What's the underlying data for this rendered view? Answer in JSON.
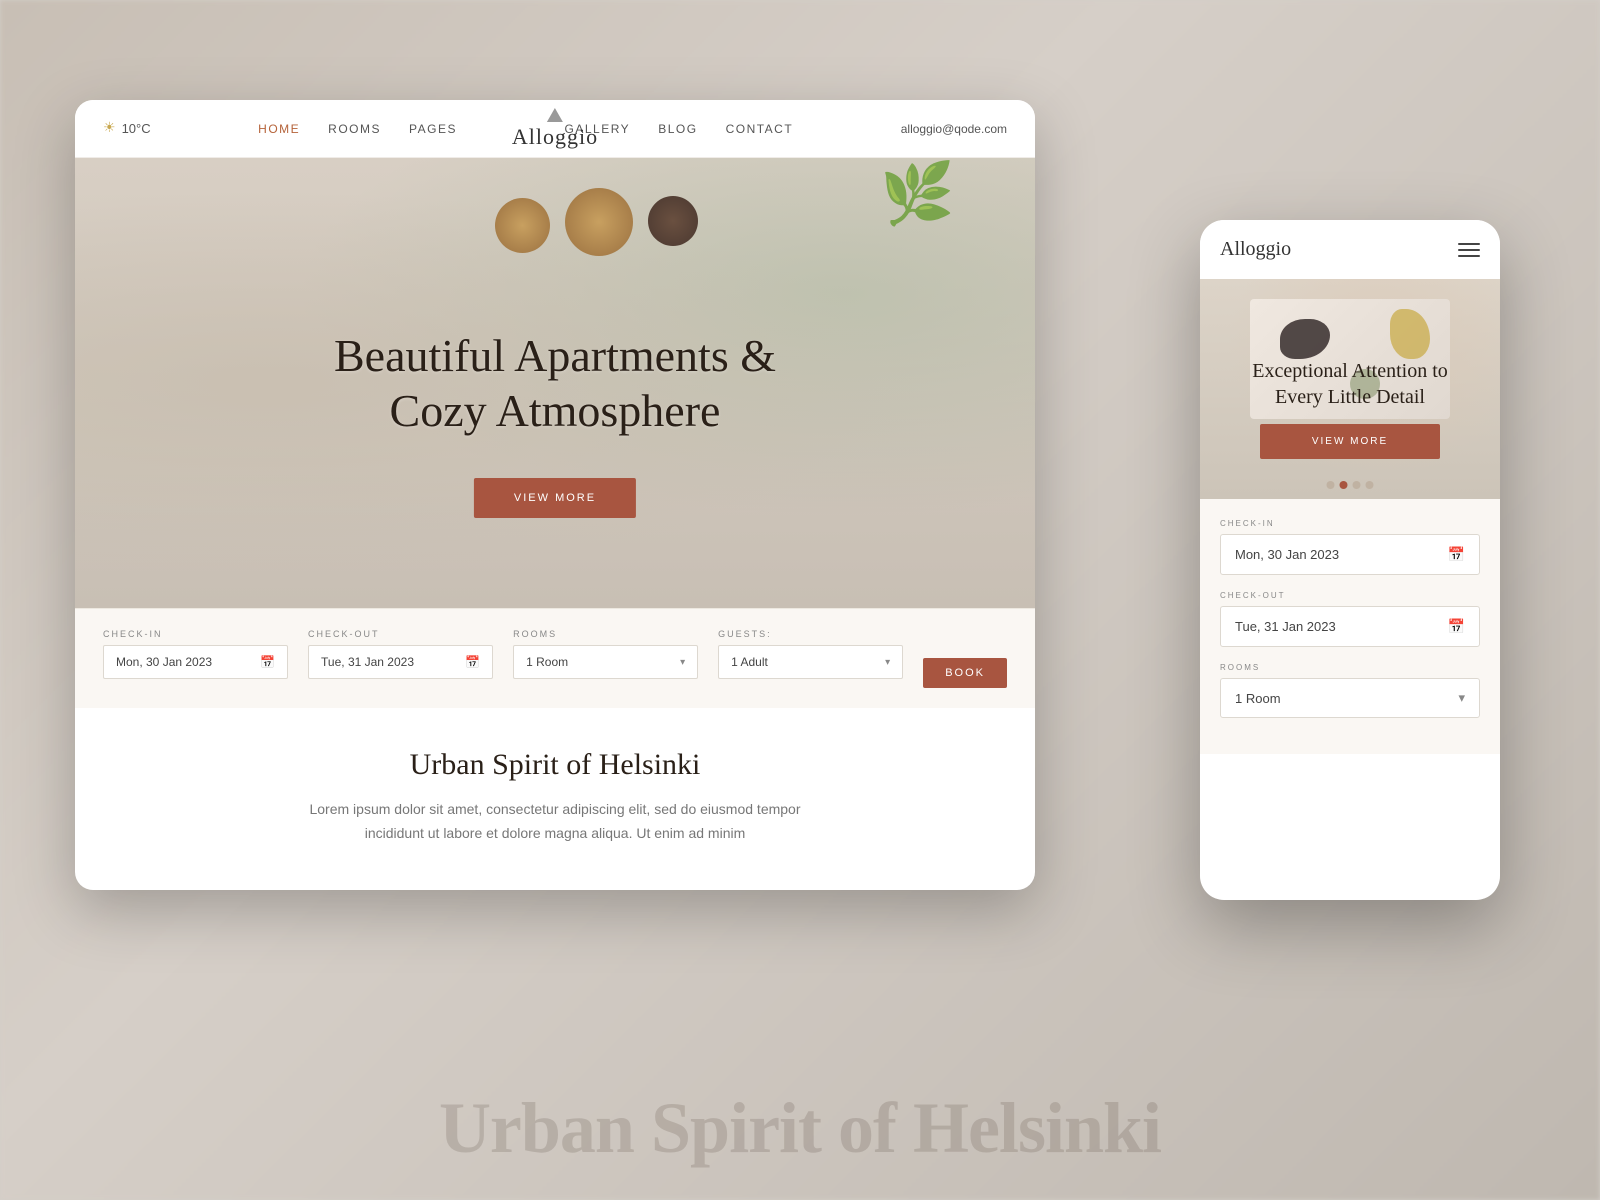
{
  "background": {
    "text": "Urban Spirit of Helsinki"
  },
  "desktop": {
    "nav": {
      "weather": "10°C",
      "links": [
        "HOME",
        "ROOMS",
        "PAGES",
        "GALLERY",
        "BLOG",
        "CONTACT"
      ],
      "active_link": "HOME",
      "logo": "Alloggio",
      "email": "alloggio@qode.com"
    },
    "hero": {
      "title_line1": "Beautiful Apartments &",
      "title_line2": "Cozy Atmosphere",
      "cta": "VIEW MORE"
    },
    "booking": {
      "checkin_label": "CHECK-IN",
      "checkin_value": "Mon, 30 Jan 2023",
      "checkout_label": "CHECK-OUT",
      "checkout_value": "Tue, 31 Jan 2023",
      "rooms_label": "ROOMS",
      "rooms_value": "1 Room",
      "guests_label": "GUESTS:",
      "guests_value": "1 Adult",
      "book_btn": "BOOK"
    },
    "content": {
      "title": "Urban Spirit of Helsinki",
      "text": "Lorem ipsum dolor sit amet, consectetur adipiscing elit, sed do eiusmod tempor incididunt ut labore et dolore magna aliqua. Ut enim ad minim"
    }
  },
  "mobile": {
    "nav": {
      "logo": "Alloggio"
    },
    "hero": {
      "title_line1": "Exceptional Attention to",
      "title_line2": "Every Little Detail",
      "cta": "VIEW MORE",
      "dots": [
        1,
        2,
        3,
        4
      ],
      "active_dot": 1
    },
    "booking": {
      "checkin_label": "CHECK-IN",
      "checkin_value": "Mon, 30 Jan 2023",
      "checkout_label": "CHECK-OUT",
      "checkout_value": "Tue, 31 Jan 2023",
      "rooms_label": "ROOMS",
      "rooms_value": "1 Room"
    }
  }
}
